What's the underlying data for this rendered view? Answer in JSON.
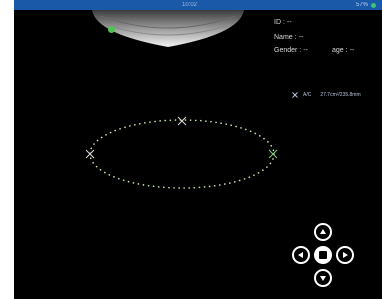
{
  "status_bar": {
    "time": "10:02",
    "battery": "57%"
  },
  "patient": {
    "id_label": "ID :",
    "id_value": "--",
    "name_label": "Name :",
    "name_value": "--",
    "gender_label": "Gender :",
    "gender_value": "--",
    "age_label": "age :",
    "age_value": "--"
  },
  "measurement": {
    "marker_label": "A/C",
    "value": "27.7cm²/235.8mm"
  },
  "icons": {
    "probe_indicator": "probe-indicator",
    "caliper_marker": "caliper-x-marker",
    "nav_up": "up-arrow",
    "nav_down": "down-arrow",
    "nav_left": "left-arrow",
    "nav_right": "right-arrow",
    "nav_center": "stop-square"
  },
  "colors": {
    "status_bar": "#1a58a8",
    "probe_dot": "#4fc34f",
    "ellipse_dots": "#c8e6a8",
    "text": "#d9d9d9"
  }
}
